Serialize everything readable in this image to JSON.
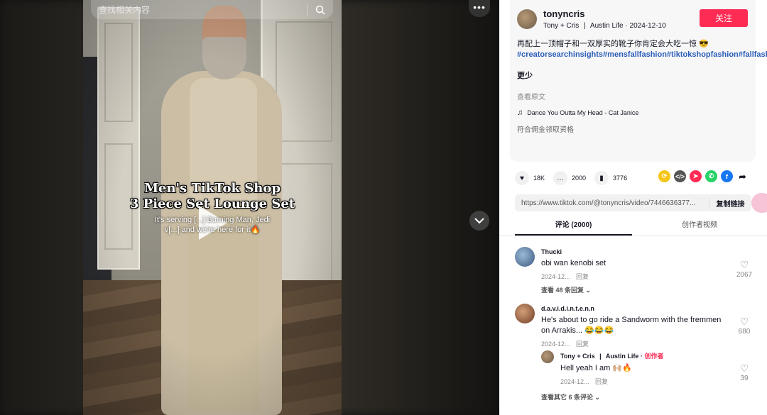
{
  "search": {
    "placeholder": "查找相关内容"
  },
  "video": {
    "more_label": "•••",
    "overlay_title_line1": "Men's TikTok Shop",
    "overlay_title_line2": "3 Piece Set Lounge Set",
    "overlay_subtitle": "It's serving [...] Burning Man, Jedi v[...] and we're here for it🔥"
  },
  "author": {
    "username": "tonyncris",
    "display_name": "Tony + Cris",
    "separator": "|",
    "location": "Austin Life",
    "date": "2024-12-10",
    "follow_label": "关注"
  },
  "description": {
    "text": "再配上一顶帽子和一双厚实的靴子你肯定会大吃一惊 😎",
    "hashtags": "#creatorsearchinsights#mensfallfashion#tiktokshopfashion#fallfashiontrends#mensfashionwear#tiktokshopootd#hothusbandcheck#ad#coofandy#tiktokshopholidayhual#festivalfashion",
    "more_label": "更少",
    "see_original": "查看原文",
    "music": "Dance You Outta My Head - Cat Janice",
    "commission": "符合佣金领取资格"
  },
  "actions": {
    "likes": "18K",
    "comments": "2000",
    "saves": "3776"
  },
  "share": {
    "url": "https://www.tiktok.com/@tonyncris/video/7446636377...",
    "copy_label": "复制链接"
  },
  "tabs": {
    "comments": "评论 (2000)",
    "creator_videos": "创作者视频"
  },
  "comments": [
    {
      "user": "Thucki",
      "text": "obi wan kenobi set",
      "date": "2024-12...",
      "reply_label": "回复",
      "likes": "2067",
      "view_replies": "查看 48 条回复 ⌄"
    },
    {
      "user": "d.a.v.i.d.i.n.t.e.n.n",
      "text": "He's about to go ride a Sandworm with the fremmen on Arrakis... 😂😂😂",
      "date": "2024-12...",
      "reply_label": "回复",
      "likes": "680"
    }
  ],
  "reply": {
    "user": "Tony + Cris",
    "separator": "|",
    "location": "Austin Life · ",
    "author_tag": "创作者",
    "text": "Hell yeah I am 🙌🏼🔥",
    "date": "2024-12...",
    "reply_label": "回复",
    "likes": "39",
    "view_other": "查看其它 6 条评论 ⌄"
  },
  "colors": {
    "accent": "#fe2c55",
    "hashtag": "#2b5db8"
  }
}
